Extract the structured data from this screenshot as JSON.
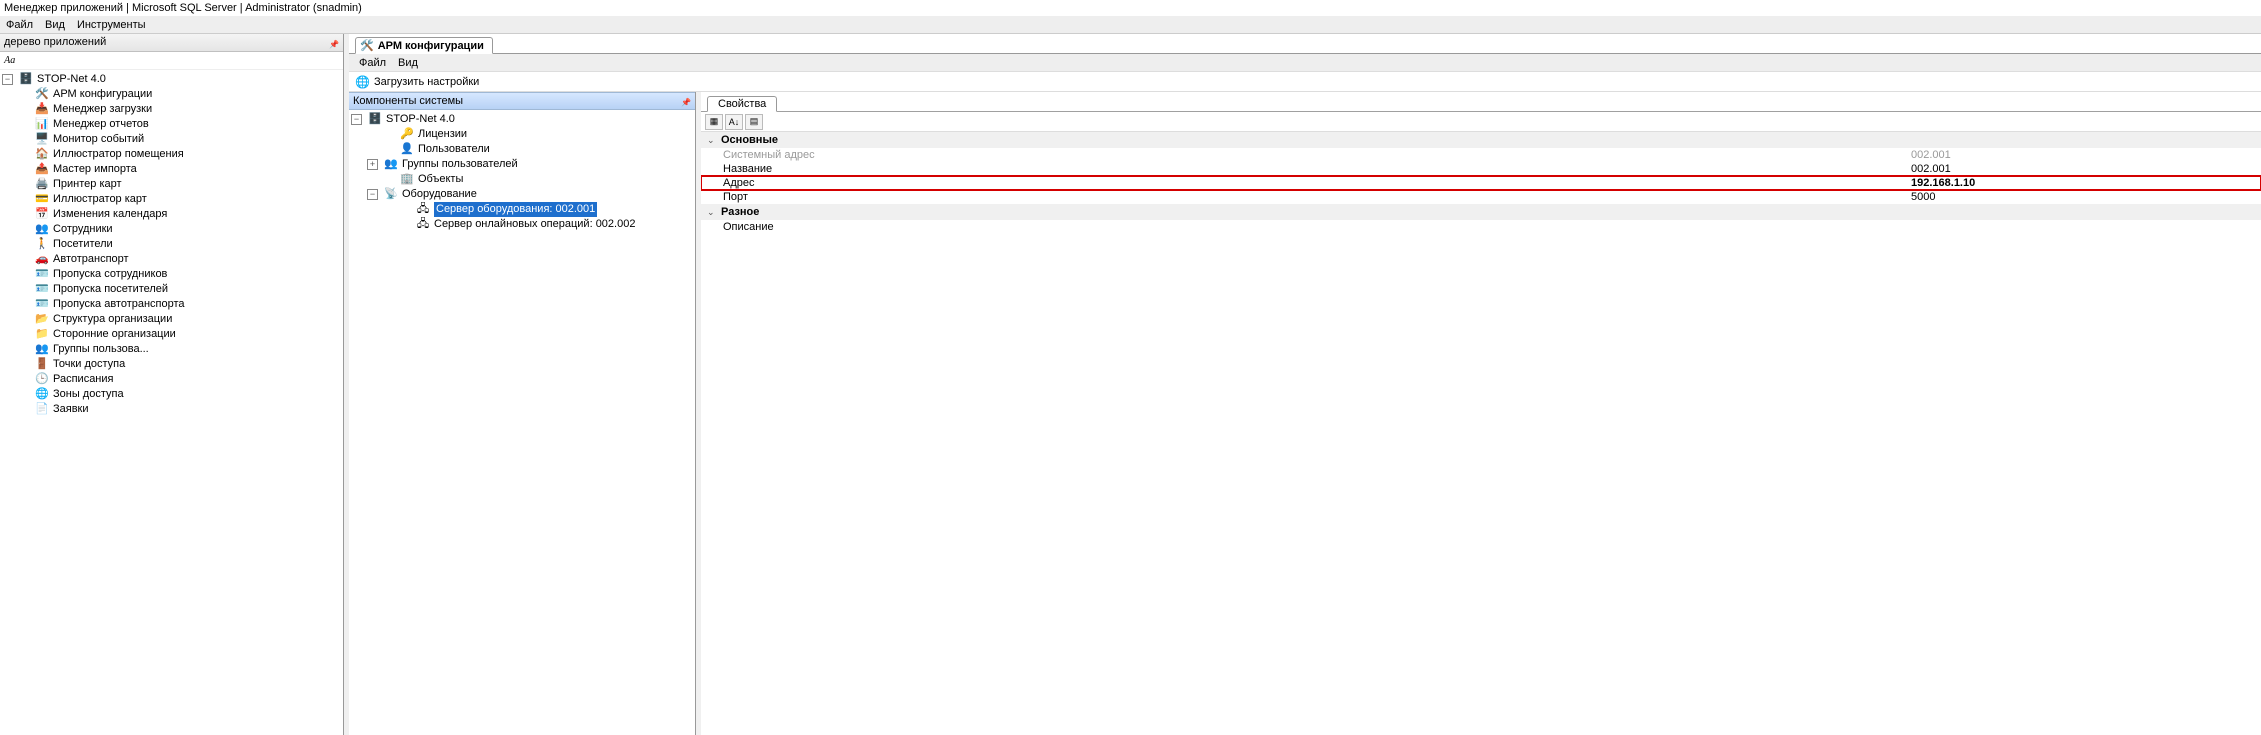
{
  "window": {
    "title": "Менеджер приложений | Microsoft SQL Server | Administrator  (snadmin)"
  },
  "main_menu": [
    "Файл",
    "Вид",
    "Инструменты"
  ],
  "left_panel": {
    "title": "дерево приложений",
    "search_placeholder": "",
    "search_icon_label": "Aa",
    "root": "STOP-Net 4.0",
    "items": [
      "АРМ конфигурации",
      "Менеджер загрузки",
      "Менеджер отчетов",
      "Монитор событий",
      "Иллюстратор помещения",
      "Мастер импорта",
      "Принтер карт",
      "Иллюстратор карт",
      "Изменения календаря",
      "Сотрудники",
      "Посетители",
      "Автотранспорт",
      "Пропуска сотрудников",
      "Пропуска посетителей",
      "Пропуска автотранспорта",
      "Структура организации",
      "Сторонние организации",
      "Группы пользова...",
      "Точки доступа",
      "Расписания",
      "Зоны доступа",
      "Заявки"
    ]
  },
  "doc_tab": {
    "label": "АРМ конфигурации"
  },
  "sub_menu": [
    "Файл",
    "Вид"
  ],
  "toolbar": {
    "load_settings": "Загрузить настройки"
  },
  "components": {
    "title": "Компоненты системы",
    "root": "STOP-Net 4.0",
    "items": [
      {
        "label": "Лицензии"
      },
      {
        "label": "Пользователи"
      },
      {
        "label": "Группы пользователей"
      },
      {
        "label": "Объекты"
      },
      {
        "label": "Оборудование"
      }
    ],
    "equipment_children": [
      {
        "label": "Сервер оборудования: 002.001",
        "selected": true
      },
      {
        "label": "Сервер онлайновых операций: 002.002",
        "selected": false
      }
    ]
  },
  "properties": {
    "tab": "Свойства",
    "categories": [
      {
        "name": "Основные",
        "rows": [
          {
            "name": "Системный адрес",
            "value": "002.001",
            "disabled": true
          },
          {
            "name": "Название",
            "value": "002.001"
          },
          {
            "name": "Адрес",
            "value": "192.168.1.10",
            "highlight": true
          },
          {
            "name": "Порт",
            "value": "5000"
          }
        ]
      },
      {
        "name": "Разное",
        "rows": [
          {
            "name": "Описание",
            "value": ""
          }
        ]
      }
    ]
  }
}
